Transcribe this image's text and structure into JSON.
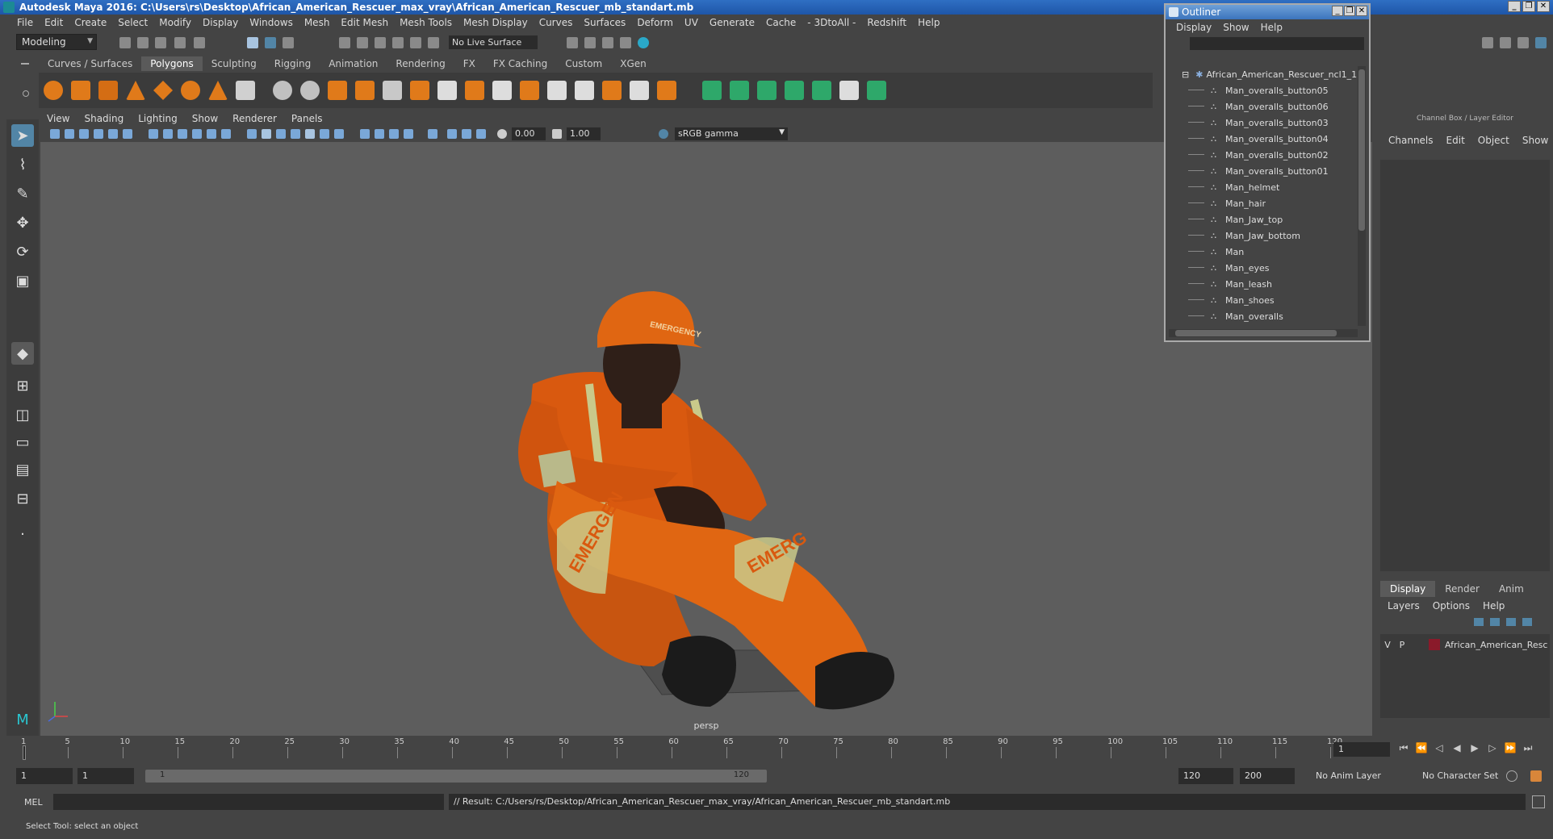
{
  "window": {
    "title": "Autodesk Maya 2016: C:\\Users\\rs\\Desktop\\African_American_Rescuer_max_vray\\African_American_Rescuer_mb_standart.mb"
  },
  "menubar": [
    "File",
    "Edit",
    "Create",
    "Select",
    "Modify",
    "Display",
    "Windows",
    "Mesh",
    "Edit Mesh",
    "Mesh Tools",
    "Mesh Display",
    "Curves",
    "Surfaces",
    "Deform",
    "UV",
    "Generate",
    "Cache",
    "- 3DtoAll -",
    "Redshift",
    "Help"
  ],
  "toolbar": {
    "mode": "Modeling",
    "live_surface": "No Live Surface"
  },
  "shelf_tabs": [
    "Curves / Surfaces",
    "Polygons",
    "Sculpting",
    "Rigging",
    "Animation",
    "Rendering",
    "FX",
    "FX Caching",
    "Custom",
    "XGen"
  ],
  "shelf_active": "Polygons",
  "panel_menu": [
    "View",
    "Shading",
    "Lighting",
    "Show",
    "Renderer",
    "Panels"
  ],
  "panel_toolbar": {
    "exposure": "0.00",
    "gamma": "1.00",
    "color_space": "sRGB gamma"
  },
  "viewport": {
    "camera": "persp",
    "helmet_text": "EMERGENCY",
    "leg_left_text": "EMERGEN",
    "leg_right_text": "EMERG"
  },
  "outliner": {
    "title": "Outliner",
    "menu": [
      "Display",
      "Show",
      "Help"
    ],
    "root": "African_American_Rescuer_ncl1_1",
    "items": [
      "Man_overalls_button05",
      "Man_overalls_button06",
      "Man_overalls_button03",
      "Man_overalls_button04",
      "Man_overalls_button02",
      "Man_overalls_button01",
      "Man_helmet",
      "Man_hair",
      "Man_Jaw_top",
      "Man_Jaw_bottom",
      "Man",
      "Man_eyes",
      "Man_leash",
      "Man_shoes",
      "Man_overalls"
    ]
  },
  "channelbox": {
    "header": "Channel Box / Layer Editor",
    "menu": [
      "Channels",
      "Edit",
      "Object",
      "Show"
    ],
    "tabs": [
      "Display",
      "Render",
      "Anim"
    ],
    "tab_active": "Display",
    "layer_menu": [
      "Layers",
      "Options",
      "Help"
    ],
    "layer": {
      "v": "V",
      "p": "P",
      "name": "African_American_Resc"
    }
  },
  "timeline": {
    "ticks": [
      "1",
      "5",
      "10",
      "15",
      "20",
      "25",
      "30",
      "35",
      "40",
      "45",
      "50",
      "55",
      "60",
      "65",
      "70",
      "75",
      "80",
      "85",
      "90",
      "95",
      "100",
      "105",
      "110",
      "115",
      "120"
    ],
    "current_frame": "1"
  },
  "range": {
    "start": "1",
    "anim_start": "1",
    "slider_start": "1",
    "slider_end": "120",
    "anim_end": "120",
    "end": "200",
    "anim_layer": "No Anim Layer",
    "character_set": "No Character Set"
  },
  "cmd": {
    "mel": "MEL",
    "result": "// Result: C:/Users/rs/Desktop/African_American_Rescuer_max_vray/African_American_Rescuer_mb_standart.mb"
  },
  "help_line": "Select Tool: select an object",
  "colors": {
    "overalls": "#d9590f",
    "ui_bg": "#444444",
    "viewport": "#5d5d5d",
    "selection_blue": "#5285a6"
  }
}
